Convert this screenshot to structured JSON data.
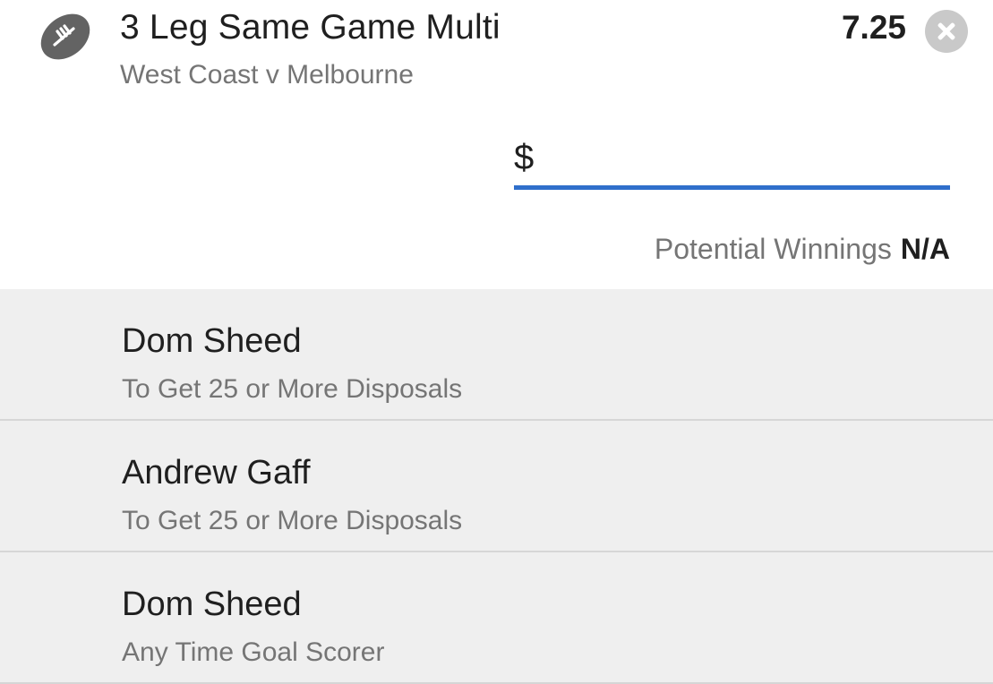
{
  "bet": {
    "title": "3 Leg Same Game Multi",
    "match": "West Coast v Melbourne",
    "odds": "7.25",
    "sport_icon": "football-icon",
    "remove_icon": "close-icon"
  },
  "stake": {
    "currency_symbol": "$",
    "value": "",
    "placeholder": ""
  },
  "winnings": {
    "label": "Potential Winnings",
    "value": "N/A"
  },
  "legs": [
    {
      "player": "Dom Sheed",
      "market": "To Get 25 or More Disposals"
    },
    {
      "player": "Andrew Gaff",
      "market": "To Get 25 or More Disposals"
    },
    {
      "player": "Dom Sheed",
      "market": "Any Time Goal Scorer"
    }
  ],
  "colors": {
    "accent": "#2f6fcb",
    "icon_grey": "#636363",
    "close_grey": "#c9c9c9",
    "leg_background": "#efefef"
  }
}
